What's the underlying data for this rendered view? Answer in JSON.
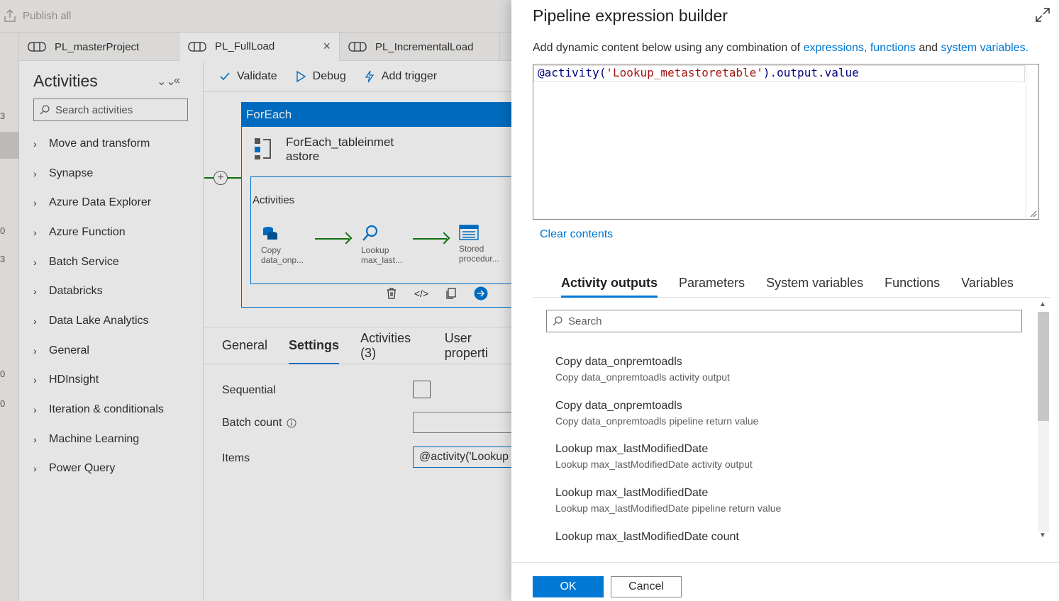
{
  "app": {
    "publish_label": "Publish all",
    "rail_marks": [
      "3",
      "0",
      "3",
      "0",
      "0"
    ],
    "tabs": [
      {
        "label": "PL_masterProject"
      },
      {
        "label": "PL_FullLoad",
        "close": "×"
      },
      {
        "label": "PL_IncrementalLoad"
      }
    ],
    "activities": {
      "title": "Activities",
      "search_placeholder": "Search activities",
      "categories": [
        "Move and transform",
        "Synapse",
        "Azure Data Explorer",
        "Azure Function",
        "Batch Service",
        "Databricks",
        "Data Lake Analytics",
        "General",
        "HDInsight",
        "Iteration & conditionals",
        "Machine Learning",
        "Power Query"
      ]
    },
    "toolbar": {
      "validate": "Validate",
      "debug": "Debug",
      "add_trigger": "Add trigger"
    },
    "foreach": {
      "header": "ForEach",
      "name_line1": "ForEach_tableinmet",
      "name_line2": "astore",
      "inner_title": "Activities",
      "nodes": [
        {
          "line1": "Copy",
          "line2": "data_onp..."
        },
        {
          "line1": "Lookup",
          "line2": "max_last..."
        },
        {
          "line1": "Stored",
          "line2": "procedur..."
        }
      ]
    },
    "props": {
      "tabs": [
        "General",
        "Settings",
        "Activities (3)",
        "User properti"
      ],
      "sequential": "Sequential",
      "batch_count": "Batch count",
      "items": "Items",
      "items_value": "@activity('Lookup"
    }
  },
  "dialog": {
    "title": "Pipeline expression builder",
    "desc_prefix": "Add dynamic content below using any combination of ",
    "link_expressions": "expressions,",
    "link_functions": "functions",
    "desc_and": " and ",
    "link_system": "system variables.",
    "code": {
      "p1": "@activity(",
      "str": "'Lookup_metastoretable'",
      "p2": ").output.value"
    },
    "clear": "Clear contents",
    "tabs": [
      "Activity outputs",
      "Parameters",
      "System variables",
      "Functions",
      "Variables"
    ],
    "search_placeholder": "Search",
    "outputs": [
      {
        "title": "Copy data_onpremtoadls",
        "sub": "Copy data_onpremtoadls activity output"
      },
      {
        "title": "Copy data_onpremtoadls",
        "sub": "Copy data_onpremtoadls pipeline return value"
      },
      {
        "title": "Lookup max_lastModifiedDate",
        "sub": "Lookup max_lastModifiedDate activity output"
      },
      {
        "title": "Lookup max_lastModifiedDate",
        "sub": "Lookup max_lastModifiedDate pipeline return value"
      },
      {
        "title": "Lookup max_lastModifiedDate count",
        "sub": ""
      }
    ],
    "ok": "OK",
    "cancel": "Cancel"
  },
  "colors": {
    "accent": "#0078d4",
    "success": "#107c10"
  }
}
